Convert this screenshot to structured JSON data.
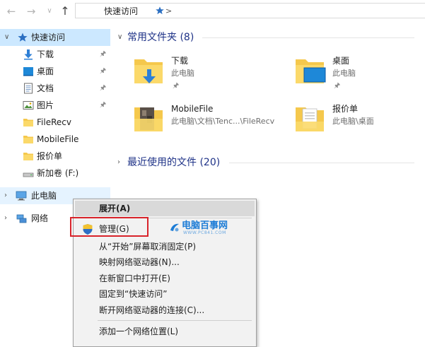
{
  "address_bar": {
    "back_glyph": "←",
    "forward_glyph": "→",
    "recent_glyph": "∨",
    "up_glyph": "↑",
    "separator": ">",
    "path": "快速访问"
  },
  "nav": {
    "quick_access": "快速访问",
    "items": [
      {
        "label": "下载",
        "icon": "download-icon",
        "pinned": true
      },
      {
        "label": "桌面",
        "icon": "desktop-icon",
        "pinned": true
      },
      {
        "label": "文档",
        "icon": "documents-icon",
        "pinned": true
      },
      {
        "label": "图片",
        "icon": "pictures-icon",
        "pinned": true
      },
      {
        "label": "FileRecv",
        "icon": "folder-icon",
        "pinned": false
      },
      {
        "label": "MobileFile",
        "icon": "folder-icon",
        "pinned": false
      },
      {
        "label": "报价单",
        "icon": "folder-icon",
        "pinned": false
      },
      {
        "label": "新加卷 (F:)",
        "icon": "drive-icon",
        "pinned": false
      }
    ],
    "this_pc": "此电脑",
    "network": "网络"
  },
  "content": {
    "frequent_title": "常用文件夹 (8)",
    "recent_title": "最近使用的文件 (20)",
    "tiles": [
      {
        "name": "下载",
        "location": "此电脑"
      },
      {
        "name": "桌面",
        "location": "此电脑"
      },
      {
        "name": "MobileFile",
        "location": "此电脑\\文档\\Tenc...\\FileRecv"
      },
      {
        "name": "报价单",
        "location": "此电脑\\桌面"
      }
    ]
  },
  "context_menu": {
    "items": [
      "展开(A)",
      "管理(G)",
      "从“开始”屏幕取消固定(P)",
      "映射网络驱动器(N)...",
      "在新窗口中打开(E)",
      "固定到“快速访问”",
      "断开网络驱动器的连接(C)...",
      "添加一个网络位置(L)"
    ]
  },
  "watermark": {
    "text": "电脑百事网",
    "sub": "WWW.PC841.COM"
  },
  "colors": {
    "selected": "#cce8ff",
    "hover": "#e5f3ff",
    "section_title": "#1e3287",
    "highlight_box": "#d8232a",
    "folder": "#f5c84c"
  }
}
